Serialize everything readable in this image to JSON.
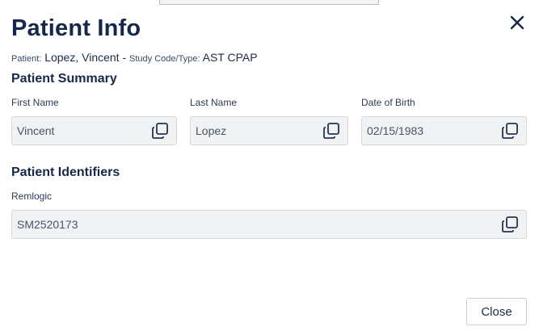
{
  "header": {
    "title": "Patient Info",
    "close_icon": "close-icon"
  },
  "meta": {
    "patient_label": "Patient:",
    "patient_name": "Lopez, Vincent",
    "separator": "-",
    "study_label": "Study Code/Type:",
    "study_value": "AST CPAP"
  },
  "patient_summary": {
    "title": "Patient Summary",
    "first_name": {
      "label": "First Name",
      "value": "Vincent"
    },
    "last_name": {
      "label": "Last Name",
      "value": "Lopez"
    },
    "dob": {
      "label": "Date of Birth",
      "value": "02/15/1983"
    }
  },
  "patient_identifiers": {
    "title": "Patient Identifiers",
    "remlogic": {
      "label": "Remlogic",
      "value": "SM2520173"
    }
  },
  "footer": {
    "close_label": "Close"
  },
  "icons": {
    "copy": "copy-icon"
  }
}
